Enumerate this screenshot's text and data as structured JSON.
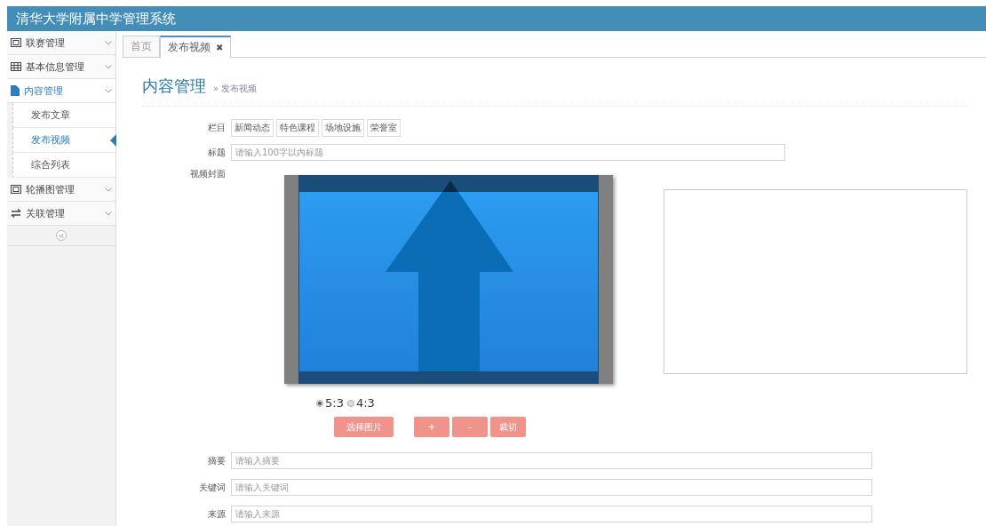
{
  "app_title": "清华大学附属中学管理系统",
  "sidebar": {
    "items": [
      {
        "label": "联赛管理",
        "expanded": false
      },
      {
        "label": "基本信息管理",
        "expanded": false
      },
      {
        "label": "内容管理",
        "expanded": true,
        "children": [
          {
            "label": "发布文章",
            "selected": false
          },
          {
            "label": "发布视频",
            "selected": true
          },
          {
            "label": "综合列表",
            "selected": false
          }
        ]
      },
      {
        "label": "轮播图管理",
        "expanded": false
      },
      {
        "label": "关联管理",
        "expanded": false
      }
    ]
  },
  "tabs": [
    {
      "label": "首页",
      "selected": false,
      "closable": false
    },
    {
      "label": "发布视频",
      "selected": true,
      "closable": true
    }
  ],
  "close_glyph": "✖",
  "page_title": "内容管理",
  "breadcrumb": "» 发布视频",
  "form": {
    "column_label": "栏目",
    "columns": [
      "新闻动态",
      "特色课程",
      "场地设施",
      "荣誉室"
    ],
    "title_label": "标题",
    "title_placeholder": "请输入100字以内标题",
    "cover_label": "视频封面",
    "ratios": [
      {
        "label": "5:3",
        "selected": true
      },
      {
        "label": "4:3",
        "selected": false
      }
    ],
    "buttons": [
      "选择图片",
      "+",
      "-",
      "裁切"
    ],
    "fields": [
      {
        "label": "摘要",
        "placeholder": "请输入摘要"
      },
      {
        "label": "关键词",
        "placeholder": "请输入关键词"
      },
      {
        "label": "来源",
        "placeholder": "请输入来源"
      }
    ]
  }
}
